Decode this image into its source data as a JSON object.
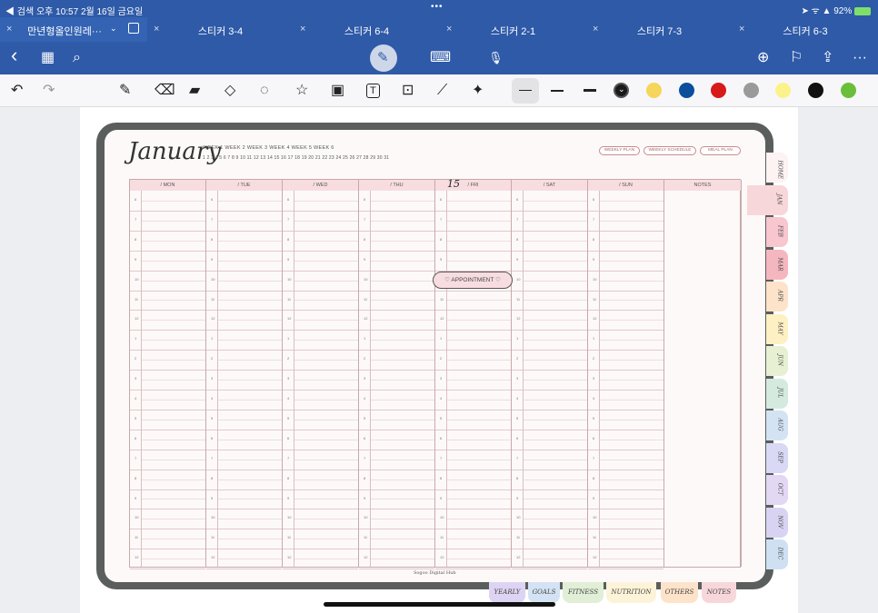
{
  "status": {
    "left": "◀ 검색  오후 10:57  2월 16일 금요일",
    "dots": "•••",
    "right": "➤ ᯤ ▲ 92%"
  },
  "tabs": [
    {
      "label": "만년형올인원레···"
    },
    {
      "label": "스티커 3-4"
    },
    {
      "label": "스티커 6-4"
    },
    {
      "label": "스티커 2-1"
    },
    {
      "label": "스티커 7-3"
    },
    {
      "label": "스티커 6-3"
    }
  ],
  "nav": {
    "back": "‹",
    "grid": "▦",
    "search": "⌕",
    "keyboard": "⌨",
    "mic": "🎙",
    "add": "⊕",
    "bookmark": "⚐",
    "share": "⇪",
    "more": "···"
  },
  "toolbar": {
    "undo": "↶",
    "redo": "↷",
    "pen": "✎",
    "eraser": "⌫",
    "highlighter": "▰",
    "shapes": "◇",
    "lasso": "◌",
    "sticker": "☆",
    "image": "▣",
    "text": "T",
    "scan": "⊡",
    "ruler": "⟋",
    "laser": "✦"
  },
  "colors": [
    "#1a1a1a",
    "#f5d55a",
    "#0b4f9c",
    "#d71a1a",
    "#9a9a9a",
    "#fbf38a",
    "#111111",
    "#6abf3a"
  ],
  "planner": {
    "month": "January",
    "weeks": "WEEK 1      WEEK 2      WEEK 3      WEEK 4      WEEK 5      WEEK 6",
    "days": "1  2  3  4  5  6  7  8  9  10  11  12  13  14  15  16  17  18  19  20  21  22  23  24  25  26  27  28  29  30  31",
    "pills": [
      "WEEKLY PLAN",
      "WEEKLY SCHEDULE",
      "MEAL PLAN"
    ],
    "columns": [
      "/ MON",
      "/ TUE",
      "/ WED",
      "/ THU",
      "/ FRI",
      "/ SAT",
      "/ SUN",
      "NOTES"
    ],
    "hours": [
      "6",
      "7",
      "8",
      "9",
      "10",
      "11",
      "12",
      "1",
      "2",
      "3",
      "4",
      "5",
      "6",
      "7",
      "8",
      "9",
      "10",
      "11",
      "12"
    ],
    "handwritten": "15",
    "appointment": "♡ APPOINTMENT ♡",
    "footer": "Sogoo Digital Hub",
    "month_tabs": [
      "HOME",
      "JAN",
      "FEB",
      "MAR",
      "APR",
      "MAY",
      "JUN",
      "JUL",
      "AUG",
      "SEP",
      "OCT",
      "NOV",
      "DEC"
    ],
    "bottom_tabs": [
      "YEARLY",
      "GOALS",
      "FITNESS",
      "NUTRITION",
      "OTHERS",
      "NOTES"
    ]
  }
}
